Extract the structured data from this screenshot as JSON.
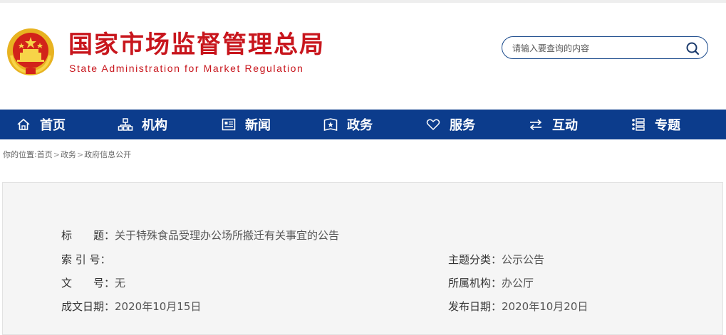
{
  "header": {
    "title_cn": "国家市场监督管理总局",
    "title_en": "State Administration for Market Regulation",
    "emblem_icon": "national-emblem-icon"
  },
  "search": {
    "placeholder": "请输入要查询的内容",
    "icon": "search-icon"
  },
  "nav": {
    "items": [
      {
        "label": "首页",
        "icon": "home-icon"
      },
      {
        "label": "机构",
        "icon": "org-chart-icon"
      },
      {
        "label": "新闻",
        "icon": "news-icon"
      },
      {
        "label": "政务",
        "icon": "government-icon"
      },
      {
        "label": "服务",
        "icon": "heart-icon"
      },
      {
        "label": "互动",
        "icon": "exchange-icon"
      },
      {
        "label": "专题",
        "icon": "topics-icon"
      }
    ]
  },
  "breadcrumb": {
    "prefix": "你的位置:",
    "items": [
      "首页",
      "政务",
      "政府信息公开"
    ],
    "separator": ">"
  },
  "info": {
    "title_label": "标　　题：",
    "title_value": "关于特殊食品受理办公场所搬迁有关事宜的公告",
    "index_label": "索 引 号：",
    "index_value": "",
    "doc_no_label": "文　　号：",
    "doc_no_value": "无",
    "created_label": "成文日期：",
    "created_value": "2020年10月15日",
    "category_label": "主题分类：",
    "category_value": "公示公告",
    "org_label": "所属机构：",
    "org_value": "办公厅",
    "published_label": "发布日期：",
    "published_value": "2020年10月20日"
  },
  "colors": {
    "brand_red": "#c8161d",
    "nav_blue": "#0c3c8c"
  }
}
